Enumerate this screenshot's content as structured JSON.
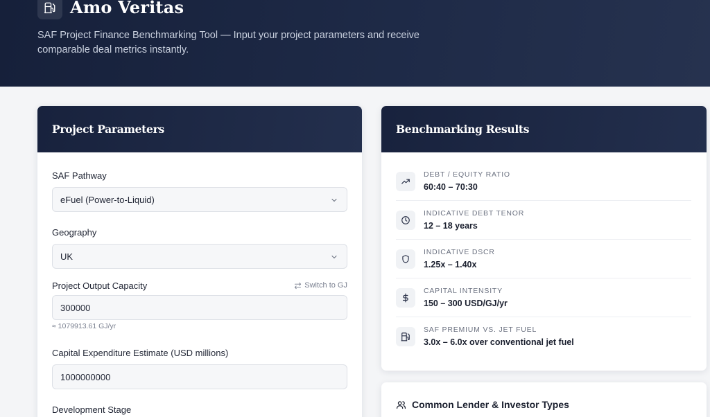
{
  "brand": {
    "name": "Amo Veritas",
    "icon": "fuel-pump-icon"
  },
  "hero": {
    "tagline": "SAF Project Finance Benchmarking Tool — Input your project parameters and receive comparable deal metrics instantly."
  },
  "params": {
    "title": "Project Parameters",
    "pathway": {
      "label": "SAF Pathway",
      "value": "eFuel (Power-to-Liquid)"
    },
    "geography": {
      "label": "Geography",
      "value": "UK"
    },
    "capacity": {
      "label": "Project Output Capacity",
      "switch_label": "Switch to GJ",
      "value": "300000",
      "hint": "≈ 1079913.61 GJ/yr"
    },
    "capex": {
      "label": "Capital Expenditure Estimate (USD millions)",
      "value": "1000000000"
    },
    "stage": {
      "label": "Development Stage"
    }
  },
  "results": {
    "title": "Benchmarking Results",
    "metrics": [
      {
        "label": "DEBT / EQUITY RATIO",
        "value": "60:40 – 70:30",
        "icon": "trending-up-icon"
      },
      {
        "label": "INDICATIVE DEBT TENOR",
        "value": "12 – 18 years",
        "icon": "clock-icon"
      },
      {
        "label": "INDICATIVE DSCR",
        "value": "1.25x – 1.40x",
        "icon": "shield-icon"
      },
      {
        "label": "CAPITAL INTENSITY",
        "value": "150 – 300 USD/GJ/yr",
        "icon": "dollar-icon"
      },
      {
        "label": "SAF PREMIUM VS. JET FUEL",
        "value": "3.0x – 6.0x over conventional jet fuel",
        "icon": "fuel-pump-icon"
      }
    ]
  },
  "lenders": {
    "title": "Common Lender & Investor Types",
    "icon": "users-icon"
  }
}
